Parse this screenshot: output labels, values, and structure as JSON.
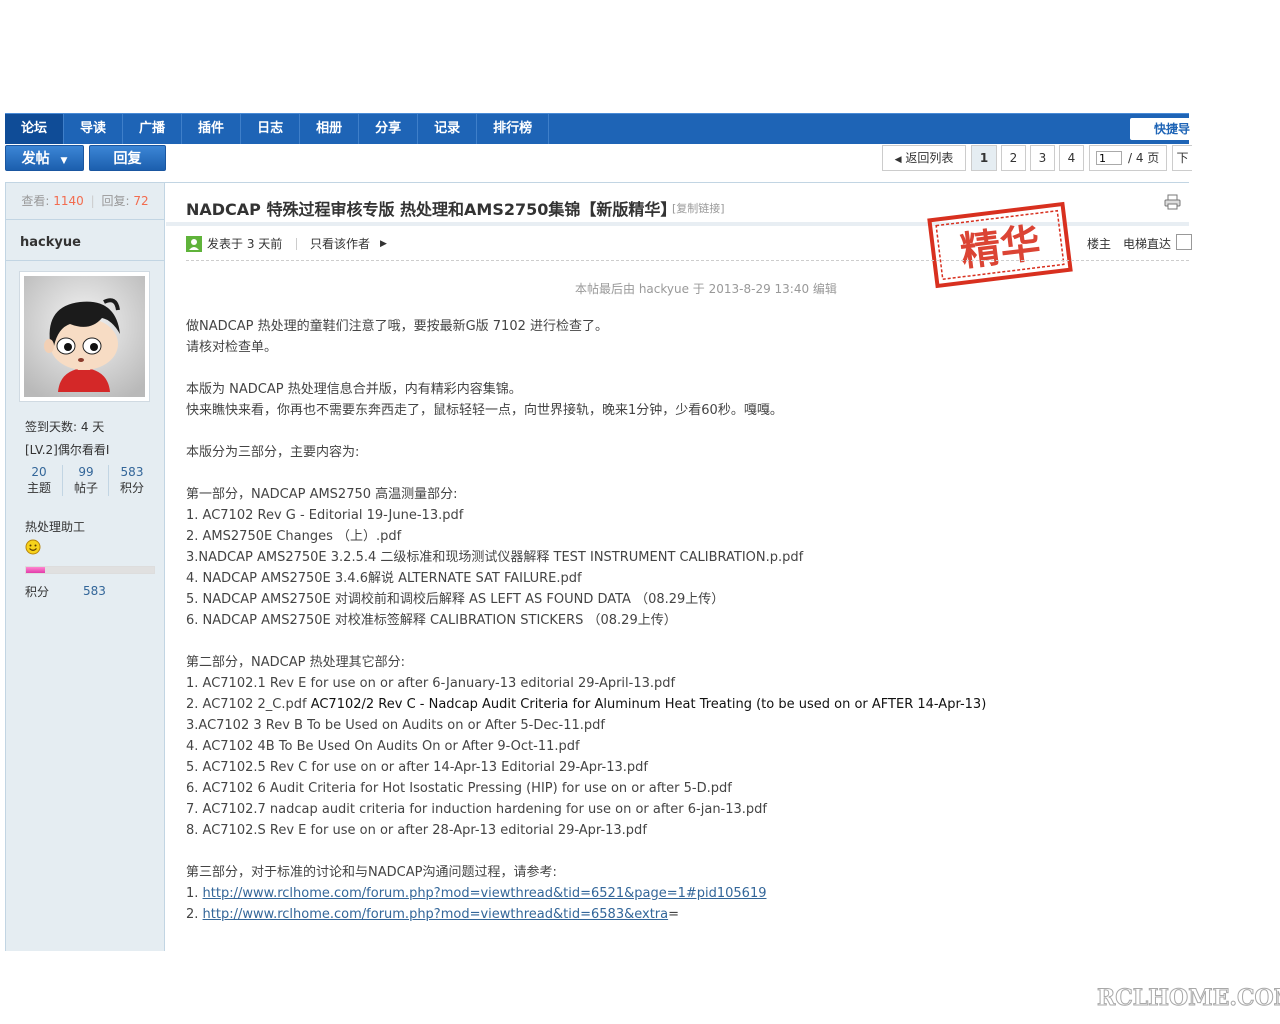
{
  "nav": {
    "items": [
      "论坛",
      "导读",
      "广播",
      "插件",
      "日志",
      "相册",
      "分享",
      "记录",
      "排行榜"
    ],
    "quick_nav": "快捷导"
  },
  "actions": {
    "post": "发帖",
    "reply": "回复"
  },
  "pagination": {
    "back": "返回列表",
    "pages": [
      "1",
      "2",
      "3",
      "4"
    ],
    "current": "1",
    "total": "/ 4 页",
    "next": "下"
  },
  "sidebar": {
    "views_label": "查看:",
    "views": "1140",
    "replies_label": "回复:",
    "replies": "72",
    "author": "hackyue",
    "sign_days": "签到天数: 4 天",
    "level": "[LV.2]偶尔看看I",
    "stats": [
      {
        "value": "20",
        "label": "主题"
      },
      {
        "value": "99",
        "label": "帖子"
      },
      {
        "value": "583",
        "label": "积分"
      }
    ],
    "user_group": "热处理助工",
    "progress_fraction": 0.15,
    "points_label": "积分",
    "points": "583"
  },
  "post": {
    "title": "NADCAP 特殊过程审核专版 热处理和AMS2750集锦【新版精华】",
    "copy_link": "[复制链接]",
    "posted_at": "发表于  3 天前",
    "only_author": "只看该作者",
    "stamp_text": "精华",
    "floor": "楼主",
    "elevator": "电梯直达",
    "edit_note": "本帖最后由  hackyue  于  2013-8-29 13:40 编辑",
    "intro": [
      "做NADCAP 热处理的童鞋们注意了哦，要按最新G版  7102 进行检查了。",
      "请核对检查单。"
    ],
    "intro2": [
      "本版为  NADCAP 热处理信息合并版，内有精彩内容集锦。",
      "快来瞧快来看，你再也不需要东奔西走了，鼠标轻轻一点，向世界接轨，晚来1分钟，少看60秒。嘎嘎。"
    ],
    "sections_intro": "本版分为三部分，主要内容为:",
    "part1_title": "第一部分，NADCAP AMS2750 高温测量部分:",
    "part1_items": [
      "1. AC7102 Rev G - Editorial 19-June-13.pdf",
      "2. AMS2750E Changes （上）.pdf",
      "3.NADCAP AMS2750E 3.2.5.4 二级标准和现场测试仪器解释  TEST INSTRUMENT CALIBRATION.p.pdf",
      "4. NADCAP AMS2750E 3.4.6解说  ALTERNATE SAT FAILURE.pdf",
      "5. NADCAP AMS2750E 对调校前和调校后解释  AS LEFT AS FOUND DATA （08.29上传）",
      "6. NADCAP AMS2750E 对校准标签解释  CALIBRATION STICKERS    （08.29上传）"
    ],
    "part2_title": "第二部分，NADCAP 热处理其它部分:",
    "part2_item1": "1. AC7102.1 Rev E for use on or after 6-January-13 editorial 29-April-13.pdf",
    "part2_item2_a": "2. AC7102 2_C.pdf ",
    "part2_item2_b": "AC7102/2 Rev C - Nadcap Audit Criteria for Aluminum Heat Treating (to be used on or AFTER 14-Apr-13)",
    "part2_items_rest": [
      "3.AC7102 3 Rev B To be Used on Audits on or After 5-Dec-11.pdf",
      "4. AC7102 4B To Be Used On Audits On or After 9-Oct-11.pdf",
      "5. AC7102.5 Rev C for use on or after 14-Apr-13 Editorial 29-Apr-13.pdf",
      "6. AC7102 6 Audit Criteria for Hot Isostatic Pressing (HIP) for use on or after 5-D.pdf",
      "7. AC7102.7 nadcap audit criteria for induction hardening for use on or after 6-jan-13.pdf",
      "8. AC7102.S Rev E for use on or after 28-Apr-13 editorial 29-Apr-13.pdf"
    ],
    "part3_title": "第三部分，对于标准的讨论和与NADCAP沟通问题过程，请参考:",
    "link1_prefix": "1. ",
    "link1": "http://www.rclhome.com/forum.php?mod=viewthread&tid=6521&page=1#pid105619",
    "link2_prefix": "2. ",
    "link2": "http://www.rclhome.com/forum.php?mod=viewthread&tid=6583&extra",
    "link2_suffix": "="
  },
  "watermark": "RCLHOME.COM",
  "colors": {
    "nav_blue": "#1e64b6",
    "accent_red": "#f26c4f",
    "stamp_red": "#d8301f",
    "link_blue": "#336699"
  }
}
